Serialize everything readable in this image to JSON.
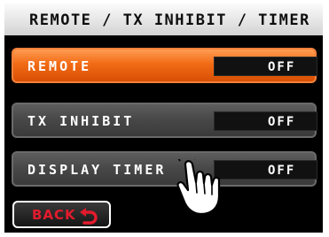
{
  "header": {
    "title": "REMOTE / TX INHIBIT / TIMER"
  },
  "rows": [
    {
      "label": "REMOTE",
      "value": "OFF"
    },
    {
      "label": "TX INHIBIT",
      "value": "OFF"
    },
    {
      "label": "DISPLAY TIMER",
      "value": "OFF"
    }
  ],
  "back": {
    "label": "BACK",
    "icon": "return-arrow-icon"
  },
  "pointer": {
    "icon": "hand-pointer-icon"
  },
  "colors": {
    "active_row": "#f26b15",
    "row": "#474747",
    "back_text": "#e21b2d",
    "header_bg": "#e8e8e8"
  }
}
